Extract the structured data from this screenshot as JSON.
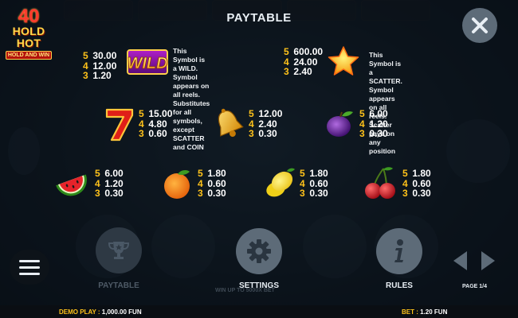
{
  "title": "PAYTABLE",
  "logo": {
    "number": "40",
    "title": "HOLD HOT",
    "subtitle": "HOLD AND WIN"
  },
  "symbols": {
    "wild": {
      "icon": "wild-symbol-icon",
      "text": "WILD",
      "pays": [
        {
          "count": "5",
          "amount": "30.00"
        },
        {
          "count": "4",
          "amount": "12.00"
        },
        {
          "count": "3",
          "amount": "1.20"
        }
      ],
      "description": [
        "This Symbol is a WILD.",
        "Symbol appears on all reels.",
        "Substitutes for all symbols,",
        "except SCATTER and COIN"
      ]
    },
    "scatter": {
      "icon": "star-scatter-icon",
      "pays": [
        {
          "count": "5",
          "amount": "600.00"
        },
        {
          "count": "4",
          "amount": "24.00"
        },
        {
          "count": "3",
          "amount": "2.40"
        }
      ],
      "description": [
        "This Symbol is a SCATTER.",
        "Symbol appears on all reels.",
        "Scatter pays on any position"
      ]
    },
    "seven": {
      "icon": "seven-icon",
      "pays": [
        {
          "count": "5",
          "amount": "15.00"
        },
        {
          "count": "4",
          "amount": "4.80"
        },
        {
          "count": "3",
          "amount": "0.60"
        }
      ]
    },
    "bell": {
      "icon": "bell-icon",
      "pays": [
        {
          "count": "5",
          "amount": "12.00"
        },
        {
          "count": "4",
          "amount": "2.40"
        },
        {
          "count": "3",
          "amount": "0.30"
        }
      ]
    },
    "plum": {
      "icon": "plum-icon",
      "pays": [
        {
          "count": "5",
          "amount": "6.00"
        },
        {
          "count": "4",
          "amount": "1.20"
        },
        {
          "count": "3",
          "amount": "0.30"
        }
      ]
    },
    "watermelon": {
      "icon": "watermelon-icon",
      "pays": [
        {
          "count": "5",
          "amount": "6.00"
        },
        {
          "count": "4",
          "amount": "1.20"
        },
        {
          "count": "3",
          "amount": "0.30"
        }
      ]
    },
    "orange": {
      "icon": "orange-icon",
      "pays": [
        {
          "count": "5",
          "amount": "1.80"
        },
        {
          "count": "4",
          "amount": "0.60"
        },
        {
          "count": "3",
          "amount": "0.30"
        }
      ]
    },
    "lemon": {
      "icon": "lemon-icon",
      "pays": [
        {
          "count": "5",
          "amount": "1.80"
        },
        {
          "count": "4",
          "amount": "0.60"
        },
        {
          "count": "3",
          "amount": "0.30"
        }
      ]
    },
    "cherry": {
      "icon": "cherry-icon",
      "pays": [
        {
          "count": "5",
          "amount": "1.80"
        },
        {
          "count": "4",
          "amount": "0.60"
        },
        {
          "count": "3",
          "amount": "0.30"
        }
      ]
    }
  },
  "buttons": {
    "paytable": {
      "label": "PAYTABLE",
      "icon": "trophy-icon"
    },
    "settings": {
      "label": "SETTINGS",
      "icon": "gear-icon"
    },
    "rules": {
      "label": "RULES",
      "icon": "info-icon"
    }
  },
  "page_indicator": "PAGE 1/4",
  "background_hint": "WIN UP TO 5000X BET",
  "status": {
    "demo_label": "DEMO PLAY : ",
    "demo_value": "1,000.00 FUN",
    "bet_label": "BET : ",
    "bet_value": "1.20 FUN"
  },
  "colors": {
    "count": "#ffc21a",
    "amount": "#ffffff",
    "button_active": "#5d6b78",
    "button_inactive": "#2e3944",
    "accent_red": "#ff3b2f"
  }
}
